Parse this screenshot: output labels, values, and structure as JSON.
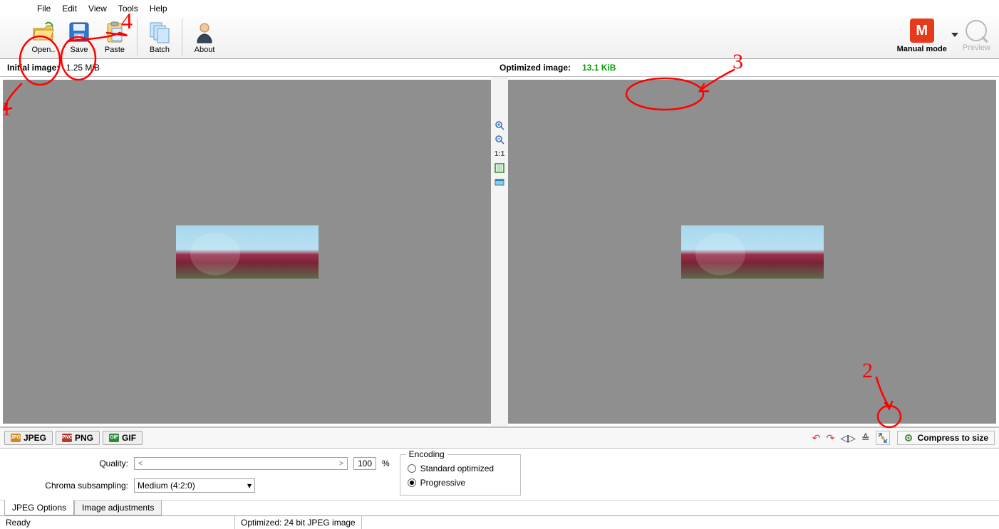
{
  "menu": {
    "file": "File",
    "edit": "Edit",
    "view": "View",
    "tools": "Tools",
    "help": "Help"
  },
  "toolbar": {
    "open": "Open..",
    "save": "Save",
    "paste": "Paste",
    "batch": "Batch",
    "about": "About",
    "mode_label": "Manual mode",
    "mode_letter": "M",
    "preview": "Preview"
  },
  "headers": {
    "initial_label": "Initial image:",
    "initial_size": "1.25 MiB",
    "optimized_label": "Optimized image:",
    "optimized_size": "13.1 KiB"
  },
  "vtools": {
    "onetoone": "1:1"
  },
  "formats": {
    "jpeg": "JPEG",
    "png": "PNG",
    "gif": "GIF"
  },
  "compress": "Compress to size",
  "options": {
    "quality_label": "Quality:",
    "quality_value": "100",
    "percent": "%",
    "chroma_label": "Chroma subsampling:",
    "chroma_value": "Medium (4:2:0)",
    "encoding_legend": "Encoding",
    "enc_std": "Standard optimized",
    "enc_prog": "Progressive"
  },
  "bottom_tabs": {
    "jpeg_opts": "JPEG Options",
    "img_adj": "Image adjustments"
  },
  "status": {
    "ready": "Ready",
    "optimized": "Optimized: 24 bit JPEG image"
  },
  "anno": {
    "n1": "1",
    "n2": "2",
    "n3": "3",
    "n4": "4"
  }
}
